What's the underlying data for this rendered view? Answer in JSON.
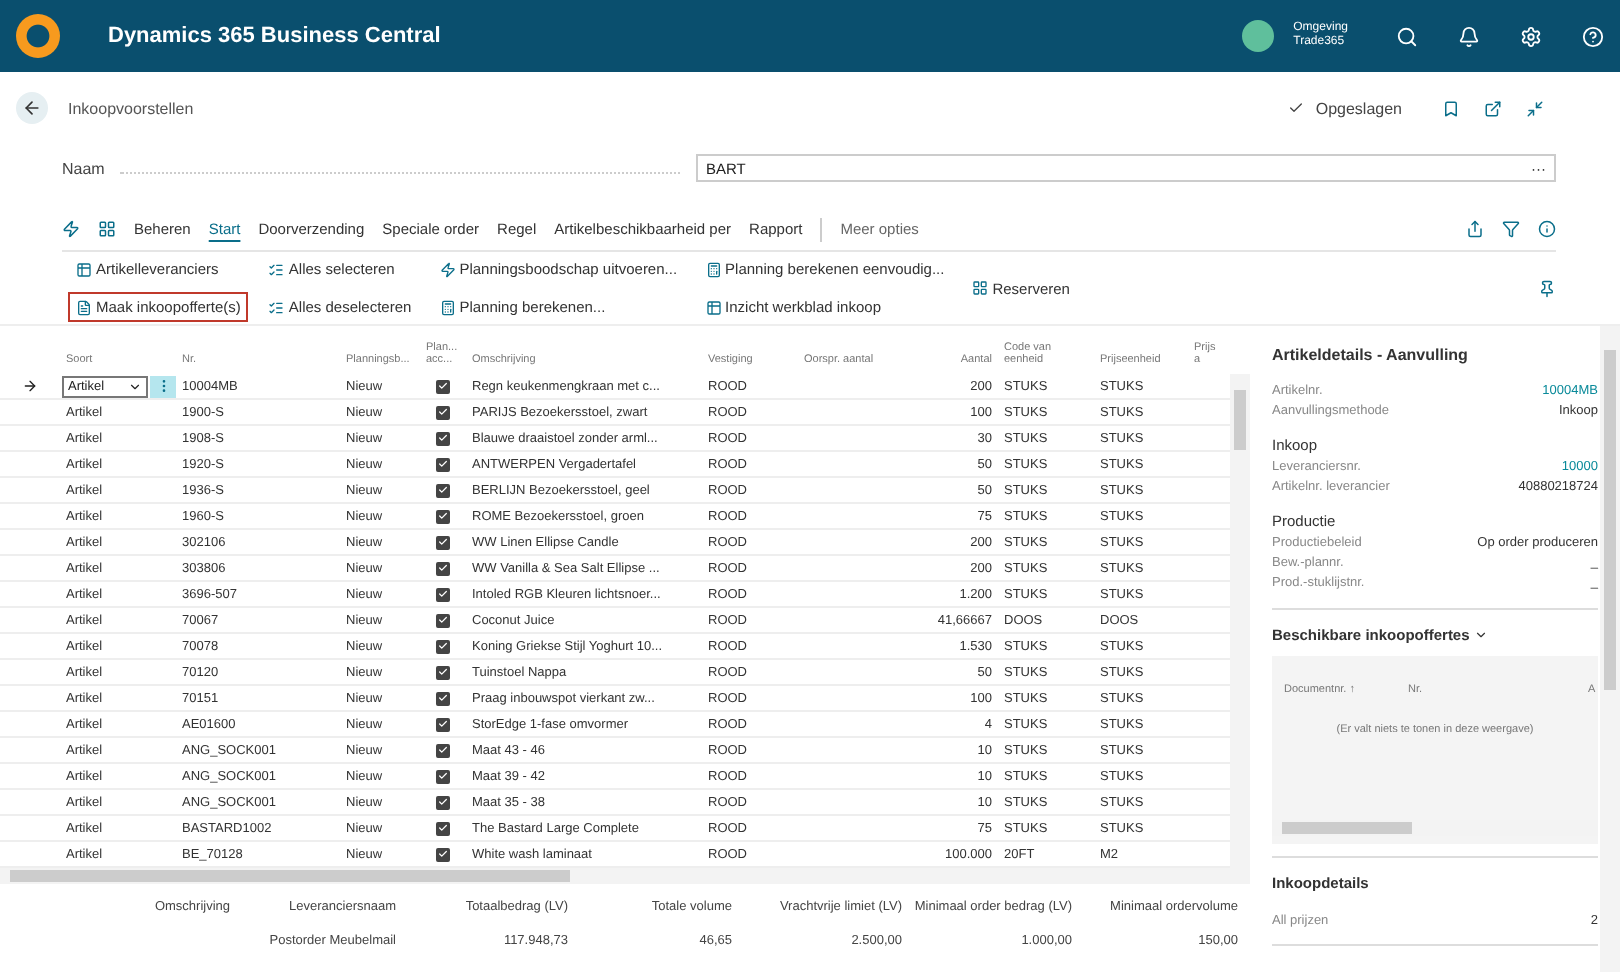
{
  "app_bar": {
    "title": "Dynamics 365 Business Central",
    "environment_label": "Omgeving",
    "environment_name": "Trade365"
  },
  "page": {
    "title": "Inkoopvoorstellen",
    "save_status": "Opgeslagen"
  },
  "name_field": {
    "label": "Naam",
    "value": "BART",
    "menu": "···"
  },
  "menu": [
    {
      "label": "Beheren",
      "selected": false
    },
    {
      "label": "Start",
      "selected": true
    },
    {
      "label": "Doorverzending",
      "selected": false
    },
    {
      "label": "Speciale order",
      "selected": false
    },
    {
      "label": "Regel",
      "selected": false
    },
    {
      "label": "Artikelbeschikbaarheid per",
      "selected": false
    },
    {
      "label": "Rapport",
      "selected": false
    }
  ],
  "more_options": "Meer opties",
  "actions": [
    [
      {
        "label": "Artikelleveranciers",
        "highlighted": false
      },
      {
        "label": "Alles selecteren",
        "highlighted": false
      },
      {
        "label": "Planningsboodschap uitvoeren...",
        "highlighted": false
      },
      {
        "label": "Planning berekenen eenvoudig...",
        "highlighted": false
      },
      {
        "label": "Reserveren",
        "highlighted": false
      }
    ],
    [
      {
        "label": "Maak inkoopofferte(s)",
        "highlighted": true
      },
      {
        "label": "Alles deselecteren",
        "highlighted": false
      },
      {
        "label": "Planning berekenen...",
        "highlighted": false
      },
      {
        "label": "Inzicht werkblad inkoop",
        "highlighted": false
      }
    ]
  ],
  "table": {
    "columns": [
      "Soort",
      "Nr.",
      "Planningsb...",
      "Plan... acc...",
      "Omschrijving",
      "Vestiging",
      "Oorspr. aantal",
      "Aantal",
      "Code van eenheid",
      "Prijseenheid",
      "Prijs a"
    ],
    "rows": [
      {
        "soort": "Artikel",
        "nr": "10004MB",
        "planning": "Nieuw",
        "accepted": true,
        "omschrijving": "Regn keukenmengkraan met c...",
        "vestiging": "ROOD",
        "aantal": "200",
        "code": "STUKS",
        "prijseenheid": "STUKS",
        "selected": true
      },
      {
        "soort": "Artikel",
        "nr": "1900-S",
        "planning": "Nieuw",
        "accepted": true,
        "omschrijving": "PARIJS Bezoekersstoel, zwart",
        "vestiging": "ROOD",
        "aantal": "100",
        "code": "STUKS",
        "prijseenheid": "STUKS",
        "selected": false
      },
      {
        "soort": "Artikel",
        "nr": "1908-S",
        "planning": "Nieuw",
        "accepted": true,
        "omschrijving": "Blauwe draaistoel zonder arml...",
        "vestiging": "ROOD",
        "aantal": "30",
        "code": "STUKS",
        "prijseenheid": "STUKS",
        "selected": false
      },
      {
        "soort": "Artikel",
        "nr": "1920-S",
        "planning": "Nieuw",
        "accepted": true,
        "omschrijving": "ANTWERPEN Vergadertafel",
        "vestiging": "ROOD",
        "aantal": "50",
        "code": "STUKS",
        "prijseenheid": "STUKS",
        "selected": false
      },
      {
        "soort": "Artikel",
        "nr": "1936-S",
        "planning": "Nieuw",
        "accepted": true,
        "omschrijving": "BERLIJN Bezoekersstoel, geel",
        "vestiging": "ROOD",
        "aantal": "50",
        "code": "STUKS",
        "prijseenheid": "STUKS",
        "selected": false
      },
      {
        "soort": "Artikel",
        "nr": "1960-S",
        "planning": "Nieuw",
        "accepted": true,
        "omschrijving": "ROME Bezoekersstoel, groen",
        "vestiging": "ROOD",
        "aantal": "75",
        "code": "STUKS",
        "prijseenheid": "STUKS",
        "selected": false
      },
      {
        "soort": "Artikel",
        "nr": "302106",
        "planning": "Nieuw",
        "accepted": true,
        "omschrijving": "WW Linen Ellipse Candle",
        "vestiging": "ROOD",
        "aantal": "200",
        "code": "STUKS",
        "prijseenheid": "STUKS",
        "selected": false
      },
      {
        "soort": "Artikel",
        "nr": "303806",
        "planning": "Nieuw",
        "accepted": true,
        "omschrijving": "WW Vanilla & Sea Salt Ellipse ...",
        "vestiging": "ROOD",
        "aantal": "200",
        "code": "STUKS",
        "prijseenheid": "STUKS",
        "selected": false
      },
      {
        "soort": "Artikel",
        "nr": "3696-507",
        "planning": "Nieuw",
        "accepted": true,
        "omschrijving": "Intoled RGB Kleuren lichtsnoer...",
        "vestiging": "ROOD",
        "aantal": "1.200",
        "code": "STUKS",
        "prijseenheid": "STUKS",
        "selected": false
      },
      {
        "soort": "Artikel",
        "nr": "70067",
        "planning": "Nieuw",
        "accepted": true,
        "omschrijving": "Coconut Juice",
        "vestiging": "ROOD",
        "aantal": "41,66667",
        "code": "DOOS",
        "prijseenheid": "DOOS",
        "selected": false
      },
      {
        "soort": "Artikel",
        "nr": "70078",
        "planning": "Nieuw",
        "accepted": true,
        "omschrijving": "Koning Griekse Stijl Yoghurt 10...",
        "vestiging": "ROOD",
        "aantal": "1.530",
        "code": "STUKS",
        "prijseenheid": "STUKS",
        "selected": false
      },
      {
        "soort": "Artikel",
        "nr": "70120",
        "planning": "Nieuw",
        "accepted": true,
        "omschrijving": "Tuinstoel Nappa",
        "vestiging": "ROOD",
        "aantal": "50",
        "code": "STUKS",
        "prijseenheid": "STUKS",
        "selected": false
      },
      {
        "soort": "Artikel",
        "nr": "70151",
        "planning": "Nieuw",
        "accepted": true,
        "omschrijving": "Praag inbouwspot vierkant zw...",
        "vestiging": "ROOD",
        "aantal": "100",
        "code": "STUKS",
        "prijseenheid": "STUKS",
        "selected": false
      },
      {
        "soort": "Artikel",
        "nr": "AE01600",
        "planning": "Nieuw",
        "accepted": true,
        "omschrijving": "StorEdge 1-fase omvormer",
        "vestiging": "ROOD",
        "aantal": "4",
        "code": "STUKS",
        "prijseenheid": "STUKS",
        "selected": false
      },
      {
        "soort": "Artikel",
        "nr": "ANG_SOCK001",
        "planning": "Nieuw",
        "accepted": true,
        "omschrijving": "Maat 43 - 46",
        "vestiging": "ROOD",
        "aantal": "10",
        "code": "STUKS",
        "prijseenheid": "STUKS",
        "selected": false
      },
      {
        "soort": "Artikel",
        "nr": "ANG_SOCK001",
        "planning": "Nieuw",
        "accepted": true,
        "omschrijving": "Maat 39 - 42",
        "vestiging": "ROOD",
        "aantal": "10",
        "code": "STUKS",
        "prijseenheid": "STUKS",
        "selected": false
      },
      {
        "soort": "Artikel",
        "nr": "ANG_SOCK001",
        "planning": "Nieuw",
        "accepted": true,
        "omschrijving": "Maat 35 - 38",
        "vestiging": "ROOD",
        "aantal": "10",
        "code": "STUKS",
        "prijseenheid": "STUKS",
        "selected": false
      },
      {
        "soort": "Artikel",
        "nr": "BASTARD1002",
        "planning": "Nieuw",
        "accepted": true,
        "omschrijving": "The Bastard Large Complete",
        "vestiging": "ROOD",
        "aantal": "75",
        "code": "STUKS",
        "prijseenheid": "STUKS",
        "selected": false
      },
      {
        "soort": "Artikel",
        "nr": "BE_70128",
        "planning": "Nieuw",
        "accepted": true,
        "omschrijving": "White wash laminaat",
        "vestiging": "ROOD",
        "aantal": "100.000",
        "code": "20FT",
        "prijseenheid": "M2",
        "selected": false
      }
    ]
  },
  "totals": [
    {
      "label": "Omschrijving"
    },
    {
      "label": "Leveranciersnaam",
      "value": "Postorder Meubelmail"
    },
    {
      "label": "Totaalbedrag (LV)",
      "value": "117.948,73"
    },
    {
      "label": "Totale volume",
      "value": "46,65"
    },
    {
      "label": "Vrachtvrije limiet (LV)",
      "value": "2.500,00"
    },
    {
      "label": "Minimaal order bedrag (LV)",
      "value": "1.000,00"
    },
    {
      "label": "Minimaal ordervolume",
      "value": "150,00"
    }
  ],
  "factbox": {
    "title": "Artikeldetails - Aanvulling",
    "groups": [
      {
        "fields": [
          {
            "label": "Artikelnr.",
            "value": "10004MB",
            "kind": "link"
          },
          {
            "label": "Aanvullingsmethode",
            "value": "Inkoop",
            "kind": "text"
          }
        ]
      },
      {
        "heading": "Inkoop",
        "fields": [
          {
            "label": "Leveranciersnr.",
            "value": "10000",
            "kind": "link"
          },
          {
            "label": "Artikelnr. leverancier",
            "value": "40880218724",
            "kind": "text"
          }
        ]
      },
      {
        "heading": "Productie",
        "fields": [
          {
            "label": "Productiebeleid",
            "value": "Op order produceren",
            "kind": "text"
          },
          {
            "label": "Bew.-plannr.",
            "value": "_",
            "kind": "text"
          },
          {
            "label": "Prod.-stuklijstnr.",
            "value": "_",
            "kind": "text"
          }
        ]
      }
    ],
    "quotes": {
      "title": "Beschikbare inkoopoffertes",
      "columns": [
        "Documentnr. ↑",
        "Nr.",
        "A"
      ],
      "empty": "(Er valt niets te tonen in deze weergave)"
    },
    "details": {
      "title": "Inkoopdetails",
      "label": "All prijzen",
      "value": "2"
    }
  }
}
